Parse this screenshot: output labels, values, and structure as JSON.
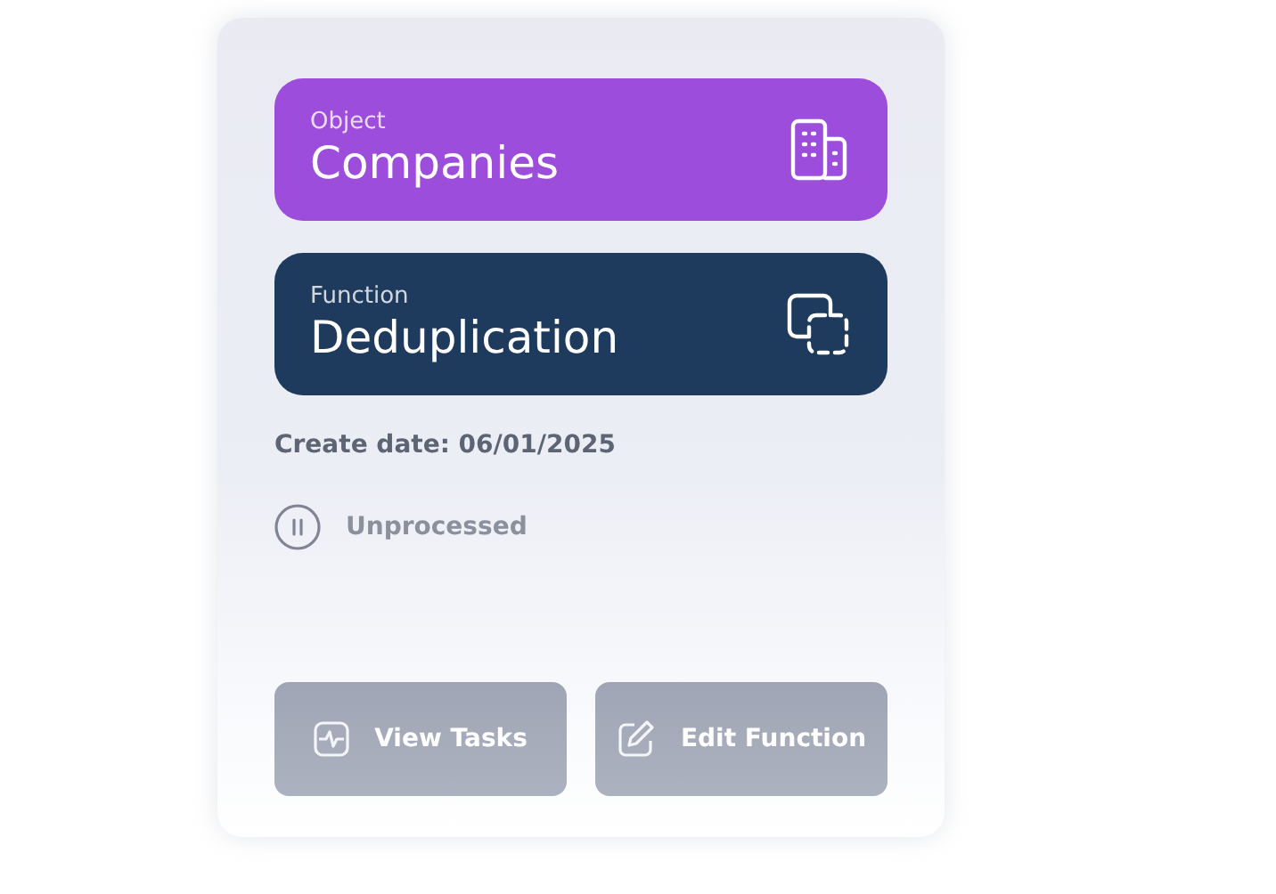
{
  "tiles": [
    {
      "kind": "object",
      "label": "Object",
      "value": "Companies"
    },
    {
      "kind": "function",
      "label": "Function",
      "value": "Deduplication"
    }
  ],
  "create_date": "Create date: 06/01/2025",
  "status": {
    "kind": "paused",
    "text": "Unprocessed"
  },
  "buttons": [
    {
      "kind": "tasks",
      "label": "View Tasks"
    },
    {
      "kind": "edit",
      "label": "Edit Function"
    }
  ]
}
